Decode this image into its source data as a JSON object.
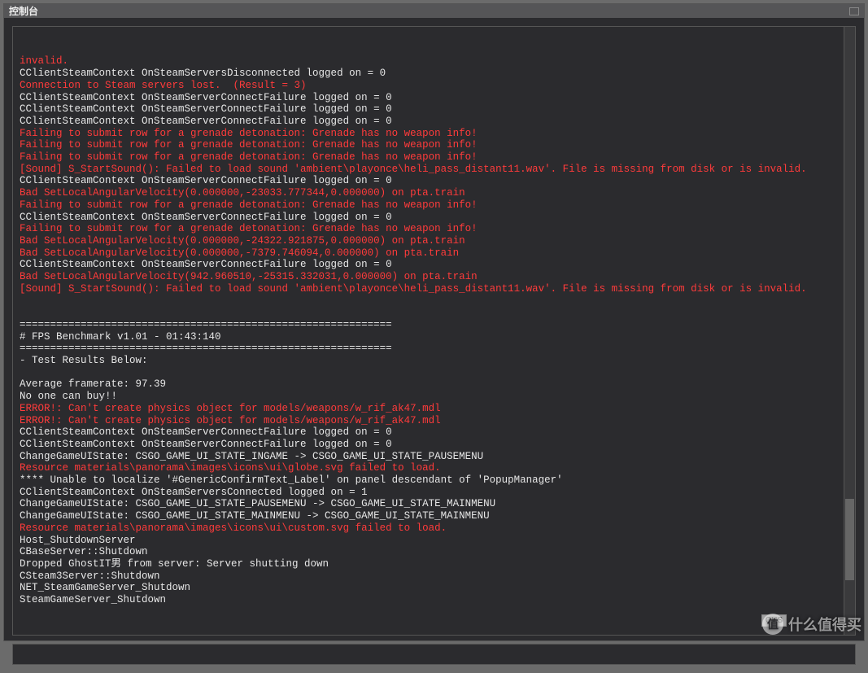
{
  "window": {
    "title": "控制台"
  },
  "log": [
    {
      "c": "red",
      "t": "invalid."
    },
    {
      "c": "white",
      "t": "CClientSteamContext OnSteamServersDisconnected logged on = 0"
    },
    {
      "c": "red",
      "t": "Connection to Steam servers lost.  (Result = 3)"
    },
    {
      "c": "white",
      "t": "CClientSteamContext OnSteamServerConnectFailure logged on = 0"
    },
    {
      "c": "white",
      "t": "CClientSteamContext OnSteamServerConnectFailure logged on = 0"
    },
    {
      "c": "white",
      "t": "CClientSteamContext OnSteamServerConnectFailure logged on = 0"
    },
    {
      "c": "red",
      "t": "Failing to submit row for a grenade detonation: Grenade has no weapon info!"
    },
    {
      "c": "red",
      "t": "Failing to submit row for a grenade detonation: Grenade has no weapon info!"
    },
    {
      "c": "red",
      "t": "Failing to submit row for a grenade detonation: Grenade has no weapon info!"
    },
    {
      "c": "red",
      "t": "[Sound] S_StartSound(): Failed to load sound 'ambient\\playonce\\heli_pass_distant11.wav'. File is missing from disk or is invalid."
    },
    {
      "c": "white",
      "t": "CClientSteamContext OnSteamServerConnectFailure logged on = 0"
    },
    {
      "c": "red",
      "t": "Bad SetLocalAngularVelocity(0.000000,-23033.777344,0.000000) on pta.train"
    },
    {
      "c": "red",
      "t": "Failing to submit row for a grenade detonation: Grenade has no weapon info!"
    },
    {
      "c": "white",
      "t": "CClientSteamContext OnSteamServerConnectFailure logged on = 0"
    },
    {
      "c": "red",
      "t": "Failing to submit row for a grenade detonation: Grenade has no weapon info!"
    },
    {
      "c": "red",
      "t": "Bad SetLocalAngularVelocity(0.000000,-24322.921875,0.000000) on pta.train"
    },
    {
      "c": "red",
      "t": "Bad SetLocalAngularVelocity(0.000000,-7379.746094,0.000000) on pta.train"
    },
    {
      "c": "white",
      "t": "CClientSteamContext OnSteamServerConnectFailure logged on = 0"
    },
    {
      "c": "red",
      "t": "Bad SetLocalAngularVelocity(942.960510,-25315.332031,0.000000) on pta.train"
    },
    {
      "c": "red",
      "t": "[Sound] S_StartSound(): Failed to load sound 'ambient\\playonce\\heli_pass_distant11.wav'. File is missing from disk or is invalid."
    },
    {
      "c": "white",
      "t": ""
    },
    {
      "c": "white",
      "t": ""
    },
    {
      "c": "white",
      "t": "============================================================="
    },
    {
      "c": "white",
      "t": "# FPS Benchmark v1.01 - 01:43:140"
    },
    {
      "c": "white",
      "t": "============================================================="
    },
    {
      "c": "white",
      "t": "- Test Results Below:"
    },
    {
      "c": "white",
      "t": ""
    },
    {
      "c": "white",
      "t": "Average framerate: 97.39"
    },
    {
      "c": "white",
      "t": "No one can buy!!"
    },
    {
      "c": "red",
      "t": "ERROR!: Can't create physics object for models/weapons/w_rif_ak47.mdl"
    },
    {
      "c": "red",
      "t": "ERROR!: Can't create physics object for models/weapons/w_rif_ak47.mdl"
    },
    {
      "c": "white",
      "t": "CClientSteamContext OnSteamServerConnectFailure logged on = 0"
    },
    {
      "c": "white",
      "t": "CClientSteamContext OnSteamServerConnectFailure logged on = 0"
    },
    {
      "c": "white",
      "t": "ChangeGameUIState: CSGO_GAME_UI_STATE_INGAME -> CSGO_GAME_UI_STATE_PAUSEMENU"
    },
    {
      "c": "red",
      "t": "Resource materials\\panorama\\images\\icons\\ui\\globe.svg failed to load."
    },
    {
      "c": "white",
      "t": "**** Unable to localize '#GenericConfirmText_Label' on panel descendant of 'PopupManager'"
    },
    {
      "c": "white",
      "t": "CClientSteamContext OnSteamServersConnected logged on = 1"
    },
    {
      "c": "white",
      "t": "ChangeGameUIState: CSGO_GAME_UI_STATE_PAUSEMENU -> CSGO_GAME_UI_STATE_MAINMENU"
    },
    {
      "c": "white",
      "t": "ChangeGameUIState: CSGO_GAME_UI_STATE_MAINMENU -> CSGO_GAME_UI_STATE_MAINMENU"
    },
    {
      "c": "red",
      "t": "Resource materials\\panorama\\images\\icons\\ui\\custom.svg failed to load."
    },
    {
      "c": "white",
      "t": "Host_ShutdownServer"
    },
    {
      "c": "white",
      "t": "CBaseServer::Shutdown"
    },
    {
      "c": "white",
      "t": "Dropped GhostIT男 from server: Server shutting down"
    },
    {
      "c": "white",
      "t": "CSteam3Server::Shutdown"
    },
    {
      "c": "white",
      "t": "NET_SteamGameServer_Shutdown"
    },
    {
      "c": "white",
      "t": "SteamGameServer_Shutdown"
    }
  ],
  "input": {
    "value": "",
    "placeholder": ""
  },
  "ime": "CHS",
  "watermark": {
    "logo": "值",
    "text": "什么值得买"
  }
}
